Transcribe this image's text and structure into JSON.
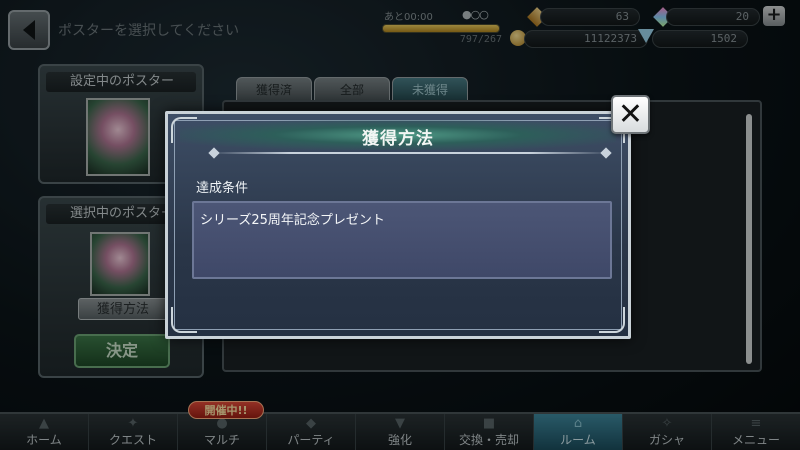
{
  "header": {
    "title": "ポスターを選択してください",
    "stamina_label": "あと00:00",
    "stamina_dots": "●○○",
    "stamina_value": "797/267",
    "stamina_fill": 1.0,
    "resource_1": "63",
    "resource_2": "20",
    "coins": "11122373",
    "diamonds": "1502",
    "plus_label": "+"
  },
  "left_panel": {
    "current_title": "設定中のポスター",
    "selected_title": "選択中のポスター",
    "method_button": "獲得方法",
    "decide_button": "決定"
  },
  "tabs": [
    {
      "label": "獲得済"
    },
    {
      "label": "全部"
    },
    {
      "label": "未獲得"
    }
  ],
  "modal": {
    "title": "獲得方法",
    "condition_label": "達成条件",
    "condition_text": "シリーズ25周年記念プレゼント",
    "close_label": "✕"
  },
  "event_badge": "開催中!!",
  "nav": [
    {
      "label": "ホーム"
    },
    {
      "label": "クエスト"
    },
    {
      "label": "マルチ"
    },
    {
      "label": "パーティ"
    },
    {
      "label": "強化"
    },
    {
      "label": "交換・売却"
    },
    {
      "label": "ルーム"
    },
    {
      "label": "ガシャ"
    },
    {
      "label": "メニュー"
    }
  ],
  "colors": {
    "accent": "#3f8aa0",
    "modal_bg": "#2a3648",
    "decide_green": "#3e7a4a",
    "badge_red": "#e24b3a"
  }
}
